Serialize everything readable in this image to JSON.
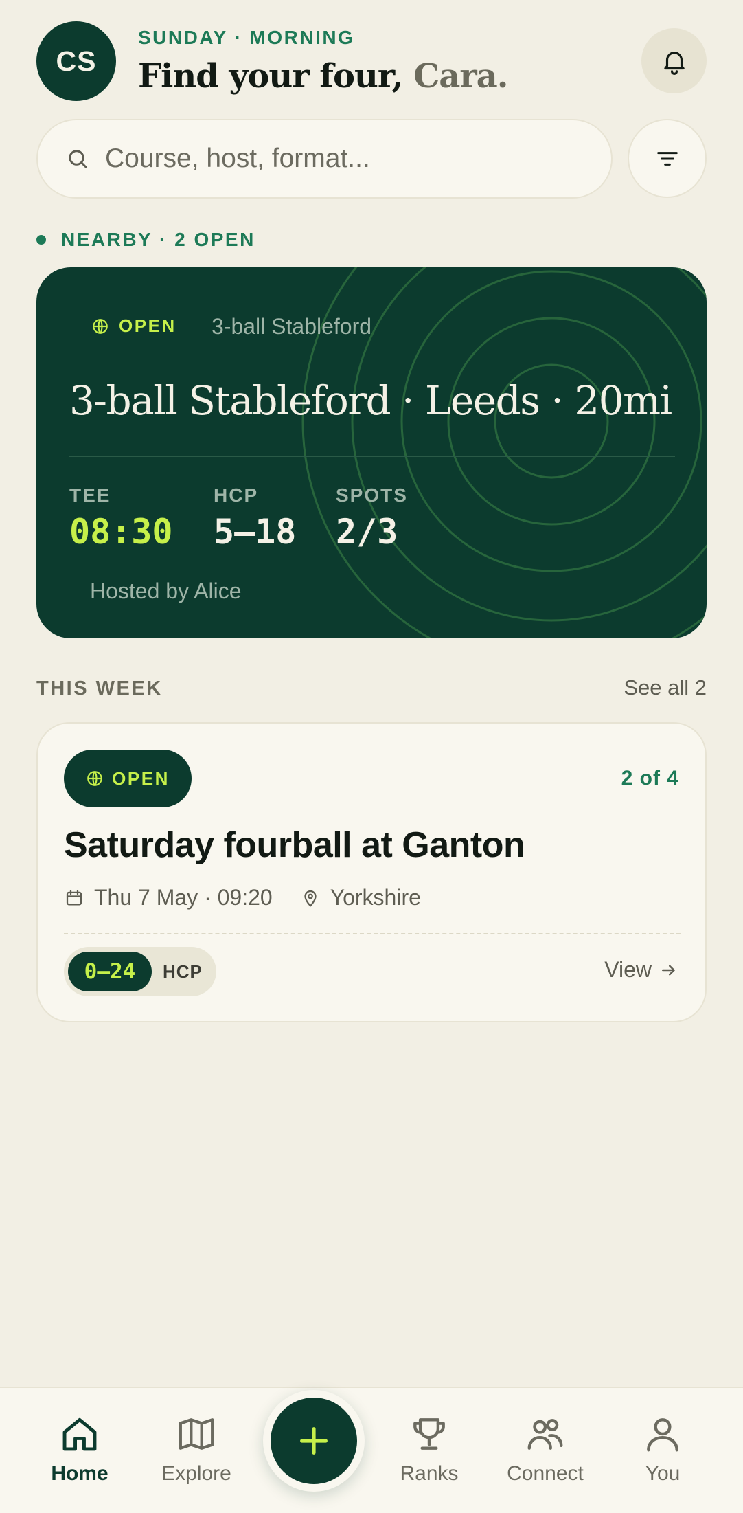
{
  "header": {
    "avatar_initials": "CS",
    "kicker": "SUNDAY · MORNING",
    "title_prefix": "Find your four,",
    "title_name": "Cara.",
    "bell_icon": "bell-icon"
  },
  "search": {
    "placeholder": "Course, host, format...",
    "icon": "search-icon",
    "filter_icon": "filter-icon"
  },
  "nearby": {
    "label": "NEARBY · 2 OPEN"
  },
  "hero": {
    "tag": "OPEN",
    "format": "3-ball Stableford",
    "title": "3-ball Stableford · Leeds · 20mi",
    "stats": [
      {
        "label": "TEE",
        "value": "08:30"
      },
      {
        "label": "HCP",
        "value": "5–18"
      },
      {
        "label": "SPOTS",
        "value": "2/3"
      }
    ],
    "host": "Hosted by Alice"
  },
  "this_week": {
    "label": "THIS WEEK",
    "see_all": "See all 2"
  },
  "event": {
    "tag": "OPEN",
    "count": "2 of 4",
    "title": "Saturday fourball at Ganton",
    "date": "Thu 7 May · 09:20",
    "location": "Yorkshire",
    "hcp_range": "0–24",
    "hcp_label": "HCP",
    "view": "View"
  },
  "tabbar": {
    "items": [
      {
        "label": "Home",
        "icon": "home-icon"
      },
      {
        "label": "Explore",
        "icon": "map-icon"
      },
      {
        "label": "Ranks",
        "icon": "trophy-icon"
      },
      {
        "label": "Connect",
        "icon": "people-icon"
      },
      {
        "label": "You",
        "icon": "user-icon"
      }
    ],
    "fab_icon": "plus-icon"
  },
  "colors": {
    "primary": "#0c3b2e",
    "accent": "#c6f04a",
    "green_text": "#1d7a57",
    "background": "#f2efe4",
    "card": "#f9f7ef"
  }
}
